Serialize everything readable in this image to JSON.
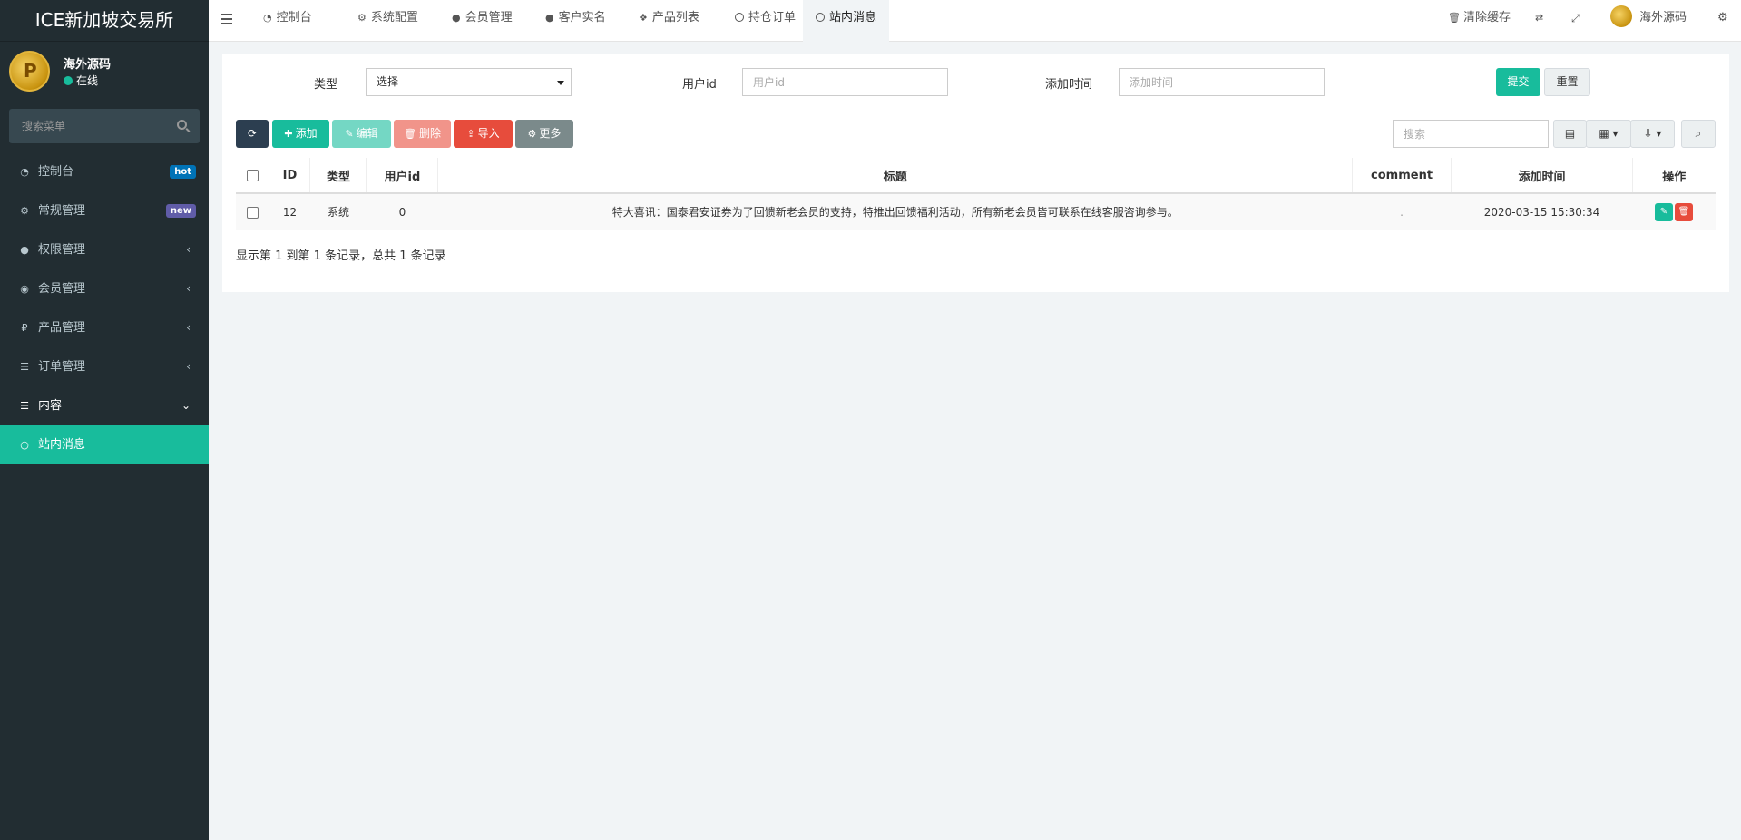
{
  "app": {
    "title": "ICE新加坡交易所"
  },
  "user": {
    "name": "海外源码",
    "status": "在线"
  },
  "sidebar": {
    "search_placeholder": "搜索菜单",
    "items": [
      {
        "label": "控制台",
        "icon": "dashboard-icon",
        "badge": "hot",
        "badge_color": "#0073b7"
      },
      {
        "label": "常规管理",
        "icon": "cogs-icon",
        "badge": "new",
        "badge_color": "#605ca8"
      },
      {
        "label": "权限管理",
        "icon": "group-icon"
      },
      {
        "label": "会员管理",
        "icon": "user-circle-icon"
      },
      {
        "label": "产品管理",
        "icon": "ruble-icon"
      },
      {
        "label": "订单管理",
        "icon": "list-icon"
      },
      {
        "label": "内容",
        "icon": "list-icon"
      },
      {
        "label": "站内消息",
        "icon": "circle-icon"
      }
    ]
  },
  "topbar": {
    "tabs": [
      {
        "label": "控制台",
        "icon": "dashboard-icon"
      },
      {
        "label": "系统配置",
        "icon": "gear-icon"
      },
      {
        "label": "会员管理",
        "icon": "user-icon"
      },
      {
        "label": "客户实名",
        "icon": "user-icon"
      },
      {
        "label": "产品列表",
        "icon": "cubes-icon"
      },
      {
        "label": "持仓订单",
        "icon": "circle-icon"
      },
      {
        "label": "站内消息",
        "icon": "circle-icon"
      }
    ],
    "clear_cache": "清除缓存",
    "username": "海外源码"
  },
  "filters": {
    "type_label": "类型",
    "type_value": "选择",
    "userid_label": "用户id",
    "userid_placeholder": "用户id",
    "addtime_label": "添加时间",
    "addtime_placeholder": "添加时间",
    "submit": "提交",
    "reset": "重置"
  },
  "toolbar": {
    "add": "添加",
    "edit": "编辑",
    "delete": "删除",
    "import": "导入",
    "more": "更多",
    "search_placeholder": "搜索"
  },
  "colors": {
    "primary": "#18bc9c",
    "dark": "#2c3e50",
    "danger": "#e74c3c",
    "gray": "#7b8a8b",
    "sidebar": "#222d32"
  },
  "table": {
    "columns": [
      "ID",
      "类型",
      "用户id",
      "标题",
      "comment",
      "添加时间",
      "操作"
    ],
    "rows": [
      {
        "id": "12",
        "type": "系统",
        "userid": "0",
        "title": "特大喜讯：国泰君安证券为了回馈新老会员的支持，特推出回馈福利活动，所有新老会员皆可联系在线客服咨询参与。",
        "comment": ".",
        "addtime": "2020-03-15 15:30:34"
      }
    ]
  },
  "pagination": {
    "info": "显示第 1 到第 1 条记录，总共 1 条记录"
  }
}
